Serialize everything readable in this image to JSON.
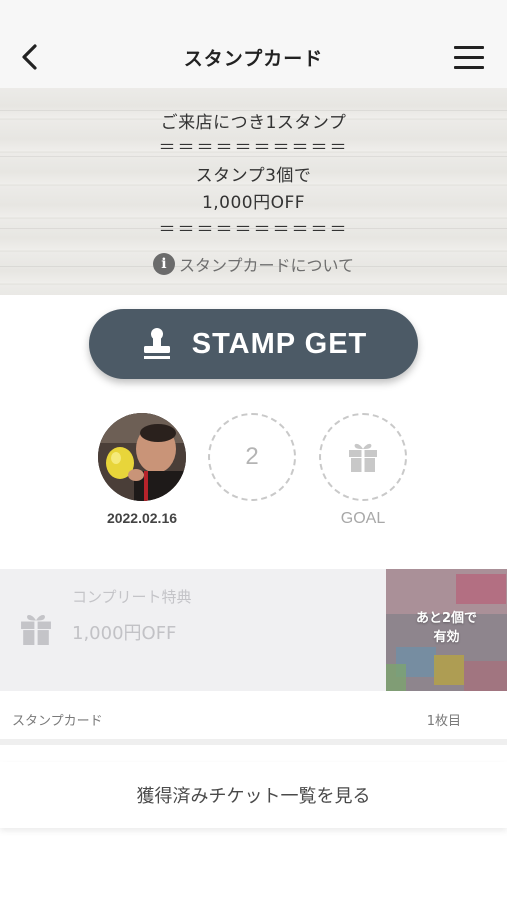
{
  "header": {
    "title": "スタンプカード",
    "back_icon": "chevron-left-icon",
    "menu_icon": "hamburger-menu-icon"
  },
  "banner": {
    "line1": "ご来店につき1スタンプ",
    "line2": "＝＝＝＝＝＝＝＝＝＝",
    "line3": "スタンプ3個で",
    "line4": "1,000円OFF",
    "line5": "＝＝＝＝＝＝＝＝＝＝",
    "about_link": "スタンプカードについて",
    "info_icon": "i"
  },
  "stamp_button": {
    "label": "STAMP GET",
    "icon": "stamp-icon",
    "color": "#4c5a66"
  },
  "stamps": [
    {
      "state": "stamped",
      "date": "2022.02.16"
    },
    {
      "state": "empty",
      "number": "2"
    },
    {
      "state": "goal",
      "label": "GOAL",
      "icon": "gift-icon"
    }
  ],
  "reward": {
    "subtitle": "コンプリート特典",
    "title": "1,000円OFF",
    "overlay_line1": "あと2個で",
    "overlay_line2": "有効"
  },
  "card": {
    "label": "スタンプカード",
    "count": "1枚目"
  },
  "tickets_button": {
    "label": "獲得済みチケット一覧を見る"
  }
}
